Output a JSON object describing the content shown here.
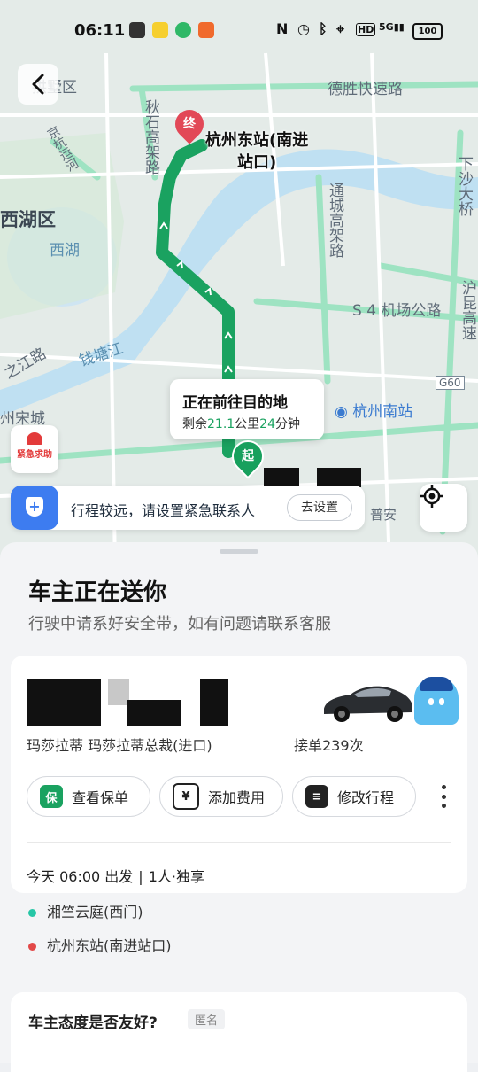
{
  "status_bar": {
    "time": "06:11",
    "battery": "100",
    "network": "5G"
  },
  "map": {
    "labels": {
      "district_top": "拱墅区",
      "road_desheng": "德胜快速路",
      "road_qiushi": "秋石高架路",
      "road_jinghang": "京杭运河",
      "road_xiasha": "下沙大桥",
      "district_xihu": "西湖区",
      "lake_xihu": "西湖",
      "road_tongcheng": "通城高架路",
      "road_jichang": "S 4 机场公路",
      "river_qiantang": "钱塘江",
      "road_zhijiang": "之江路",
      "road_huyun": "沪昆高速",
      "g60": "G60",
      "song_city": "州宋城",
      "station_nan": "杭州南站",
      "qiantang_label": "钱塘江",
      "pu_an": "普安"
    },
    "destination": {
      "pin_label": "终",
      "name_line1": "杭州东站(南进",
      "name_line2": "站口)"
    },
    "status_bubble": {
      "title": "正在前往目的地",
      "remaining_prefix": "剩余",
      "distance": "21.1",
      "distance_unit": "公里",
      "minutes": "24",
      "minutes_unit": "分钟"
    },
    "start_pin_label": "起",
    "sos_label": "紧急求助",
    "emergency_bar": {
      "message": "行程较远，请设置紧急联系人",
      "button": "去设置"
    }
  },
  "sheet": {
    "title": "车主正在送你",
    "subtitle": "行驶中请系好安全带，如有问题请联系客服",
    "driver_card": {
      "car_model": "玛莎拉蒂 玛莎拉蒂总裁(进口)",
      "car_model_prefix": "玛莎拉蒂",
      "orders": "接单239次",
      "orders_suffix": "2",
      "actions": [
        {
          "icon": "保",
          "label": "查看保单"
        },
        {
          "icon": "¥",
          "label": "添加费用"
        },
        {
          "icon": "≡",
          "label": "修改行程"
        }
      ],
      "trip_time": "今天 06:00 出发",
      "trip_people": "1人·独享"
    },
    "stops": {
      "origin": "湘竺云庭(西门)",
      "destination": "杭州东站(南进站口)"
    },
    "feedback": {
      "question": "车主态度是否友好?",
      "tag": "匿名"
    }
  },
  "colors": {
    "route_green": "#1aa260",
    "dest_red": "#e24857",
    "shield_blue": "#3d7cf0",
    "origin_dot": "#26c6a6",
    "dest_dot": "#e24848"
  }
}
